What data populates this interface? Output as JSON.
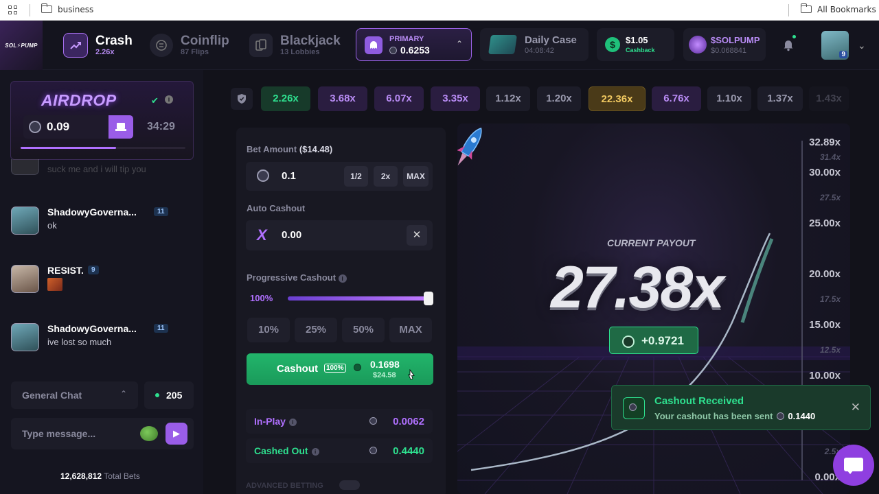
{
  "bookmarks": {
    "folder": "business",
    "all": "All Bookmarks"
  },
  "nav": {
    "logo": "SOL⚡PUMP",
    "games": [
      {
        "name": "Crash",
        "sub": "2.26x"
      },
      {
        "name": "Coinflip",
        "sub": "87 Flips"
      },
      {
        "name": "Blackjack",
        "sub": "13 Lobbies"
      }
    ],
    "wallet": {
      "label": "PRIMARY",
      "value": "0.6253"
    },
    "daily_case": {
      "title": "Daily Case",
      "timer": "04:08:42"
    },
    "cashback": {
      "amount": "$1.05",
      "label": "Cashback"
    },
    "token": {
      "name": "$SOLPUMP",
      "value": "$0.068841"
    },
    "user_level": "9",
    "colors": {
      "accent": "#9b63e8",
      "green": "#2ee08f"
    }
  },
  "airdrop": {
    "title": "AIRDROP",
    "amount": "0.09",
    "timer": "34:29",
    "progress": 0.58
  },
  "chat": {
    "faded_text": "suck me and i will tip you",
    "messages": [
      {
        "name": "ShadowyGoverna...",
        "level": "11",
        "text": "ok"
      },
      {
        "name": "RESIST.",
        "level": "9",
        "text": ""
      },
      {
        "name": "ShadowyGoverna...",
        "level": "11",
        "text": "ive lost so much"
      }
    ],
    "room": "General Chat",
    "online": "205",
    "placeholder": "Type message...",
    "total_bets_num": "12,628,812",
    "total_bets_label": "Total Bets"
  },
  "history": [
    "2.26x",
    "3.68x",
    "6.07x",
    "3.35x",
    "1.12x",
    "1.20x",
    "22.36x",
    "6.76x",
    "1.10x",
    "1.37x",
    "1.43x"
  ],
  "bet": {
    "label": "Bet Amount",
    "usd": "($14.48)",
    "amount": "0.1",
    "half": "1/2",
    "double": "2x",
    "max": "MAX",
    "auto_label": "Auto Cashout",
    "auto_value": "0.00",
    "auto_x": "X",
    "progressive_label": "Progressive Cashout",
    "progressive_pct": "100%",
    "progressive_value": 1.0,
    "pct_buttons": [
      "10%",
      "25%",
      "50%",
      "MAX"
    ],
    "cashout_label": "Cashout",
    "cashout_badge": "100%",
    "cashout_amount": "0.1698",
    "cashout_usd": "$24.58",
    "inplay_label": "In-Play",
    "inplay_value": "0.0062",
    "cashed_label": "Cashed Out",
    "cashed_value": "0.4440",
    "advanced": "ADVANCED BETTING"
  },
  "game": {
    "payout_label": "CURRENT PAYOUT",
    "payout": "27.38x",
    "profit": "+0.9721",
    "yticks_major": [
      "32.89x",
      "30.00x",
      "25.00x",
      "20.00x",
      "15.00x",
      "10.00x",
      "0.00x"
    ],
    "yticks_minor": [
      "31.4x",
      "27.5x",
      "17.5x",
      "12.5x",
      "2.5x"
    ]
  },
  "toast": {
    "title": "Cashout Received",
    "text": "Your cashout has been sent",
    "amount": "0.1440"
  }
}
